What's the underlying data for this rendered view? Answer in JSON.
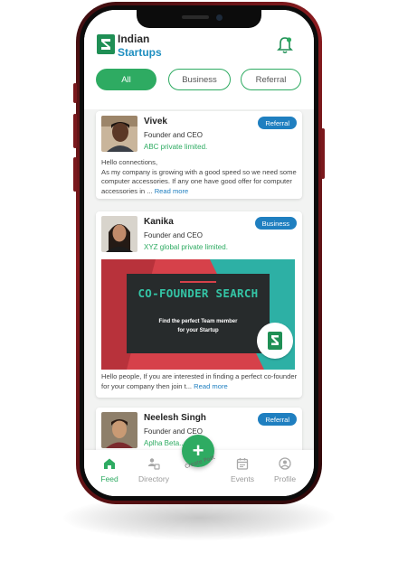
{
  "header": {
    "brand_line1": "Indian",
    "brand_line2": "Startups"
  },
  "filters": [
    {
      "label": "All",
      "active": true
    },
    {
      "label": "Business",
      "active": false
    },
    {
      "label": "Referral",
      "active": false
    }
  ],
  "posts": [
    {
      "name": "Vivek",
      "role": "Founder and CEO",
      "company": "ABC private limited.",
      "tag": "Referral",
      "text": "Hello connections,\nAs my company is growing with a good speed so we need some computer accessories. If any one have good offer for computer accessories in ...",
      "more": "Read more"
    },
    {
      "name": "Kanika",
      "role": "Founder and CEO",
      "company": "XYZ global private limited.",
      "tag": "Business",
      "banner_title": "CO-FOUNDER SEARCH",
      "banner_sub_line1": "Find the perfect Team member",
      "banner_sub_line2": "for your Startup",
      "text": "Hello people, If you are interested in finding a perfect co-founder for your company then join t...",
      "more": "Read more"
    },
    {
      "name": "Neelesh Singh",
      "role": "Founder and CEO",
      "company": "Aplha Beta...",
      "tag": "Referral"
    }
  ],
  "nav": {
    "feed": "Feed",
    "directory": "Directory",
    "events": "Events",
    "profile": "Profile",
    "fab_symbol": "+",
    "fab_caption": "Create Post"
  },
  "colors": {
    "accent": "#2eab62",
    "brand_blue": "#1f7fc0",
    "phone": "#8a1b1f"
  }
}
